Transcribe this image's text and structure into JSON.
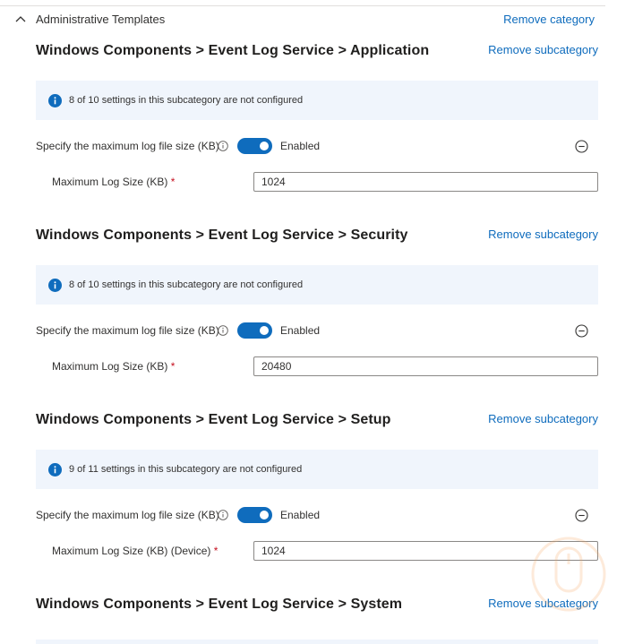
{
  "category": {
    "title": "Administrative Templates",
    "remove_label": "Remove category",
    "icon": "chevron-up-icon"
  },
  "subcategories": [
    {
      "title": "Windows Components > Event Log Service > Application",
      "remove_label": "Remove subcategory",
      "info": "8 of 10 settings in this subcategory are not configured",
      "setting_label": "Specify the maximum log file size (KB)",
      "toggle_label": "Enabled",
      "field_label": "Maximum Log Size (KB)",
      "required_mark": "*",
      "field_value": "1024"
    },
    {
      "title": "Windows Components > Event Log Service > Security",
      "remove_label": "Remove subcategory",
      "info": "8 of 10 settings in this subcategory are not configured",
      "setting_label": "Specify the maximum log file size (KB)",
      "toggle_label": "Enabled",
      "field_label": "Maximum Log Size (KB)",
      "required_mark": "*",
      "field_value": "20480"
    },
    {
      "title": "Windows Components > Event Log Service > Setup",
      "remove_label": "Remove subcategory",
      "info": "9 of 11 settings in this subcategory are not configured",
      "setting_label": "Specify the maximum log file size (KB)",
      "toggle_label": "Enabled",
      "field_label": "Maximum Log Size (KB) (Device)",
      "required_mark": "*",
      "field_value": "1024"
    },
    {
      "title": "Windows Components > Event Log Service > System",
      "remove_label": "Remove subcategory"
    }
  ],
  "icons": {
    "info": "info-icon",
    "help": "help-circle-icon",
    "collapse": "minus-circle-icon",
    "watermark": "mouse-watermark-icon"
  },
  "colors": {
    "accent": "#0f6cbd",
    "info_background": "#f0f5fc",
    "required": "#c50f1f",
    "watermark": "#f7a35c"
  }
}
